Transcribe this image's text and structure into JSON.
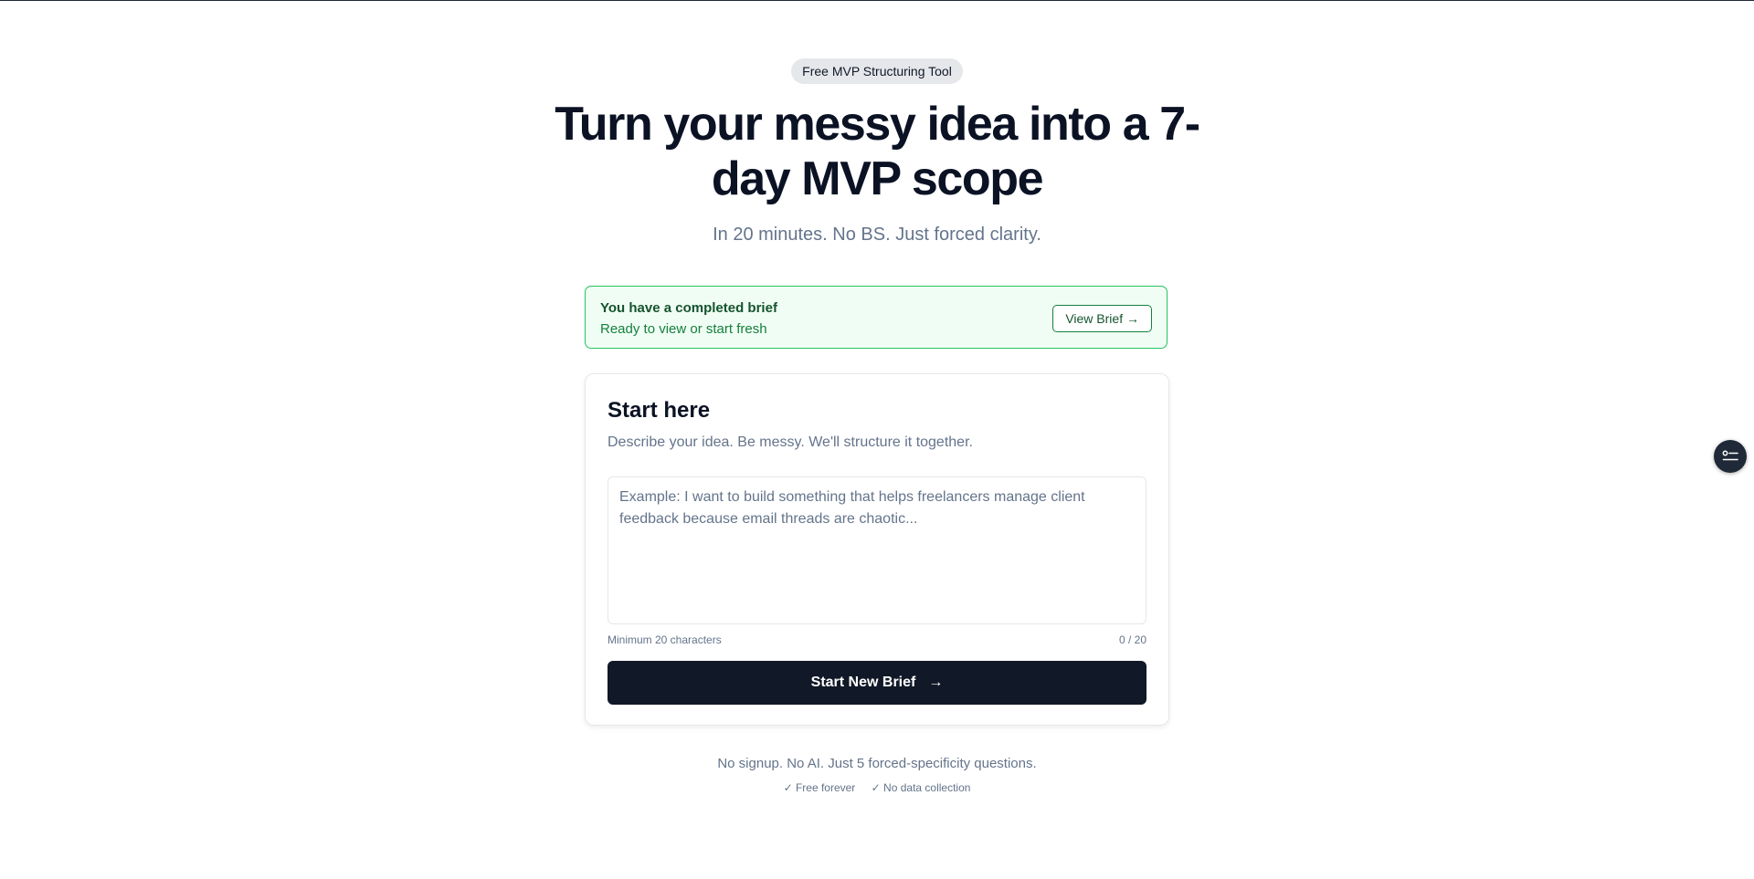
{
  "hero": {
    "badge": "Free MVP Structuring Tool",
    "headline": "Turn your messy idea into a 7-day MVP scope",
    "subheadline": "In 20 minutes. No BS. Just forced clarity."
  },
  "notice": {
    "title": "You have a completed brief",
    "subtitle": "Ready to view or start fresh",
    "button_label": "View Brief →"
  },
  "card": {
    "title": "Start here",
    "subtitle": "Describe your idea. Be messy. We'll structure it together.",
    "input_value": "",
    "input_placeholder": "Example: I want to build something that helps freelancers manage client feedback because email threads are chaotic...",
    "min_hint": "Minimum 20 characters",
    "counter": "0 / 20",
    "button_label": "Start New Brief",
    "button_arrow": "→"
  },
  "footer": {
    "line": "No signup. No AI. Just 5 forced-specificity questions.",
    "checks": [
      "✓ Free forever",
      "✓ No data collection"
    ]
  },
  "colors": {
    "accent_dark": "#111827",
    "success_border": "#22c55e",
    "success_bg": "#f0fdf4",
    "muted_text": "#64748b"
  },
  "icons": {
    "floating_button": "list-settings-icon"
  }
}
